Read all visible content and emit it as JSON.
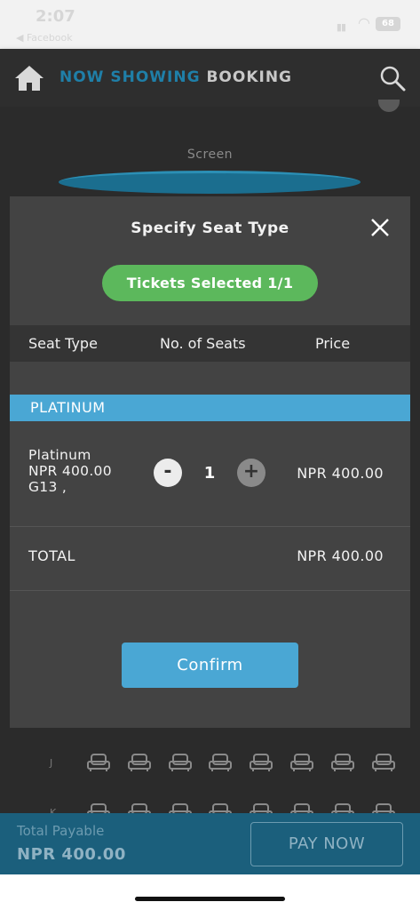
{
  "status_bar": {
    "time": "2:07",
    "back_label": "◀ Facebook",
    "signal": "▮▮",
    "wifi": "◠",
    "battery": "68"
  },
  "header": {
    "title_part1": "NOW SHOWING",
    "title_part2": "BOOKING",
    "home_icon": "home-icon",
    "search_icon": "search-icon"
  },
  "seat_map": {
    "screen_label": "Screen",
    "rows": [
      "J",
      "K"
    ],
    "seats_per_row": 8
  },
  "modal": {
    "title": "Specify Seat Type",
    "tickets_selected": "Tickets Selected 1/1",
    "columns": [
      "Seat Type",
      "No. of Seats",
      "Price"
    ],
    "section": "PLATINUM",
    "item": {
      "name": "Platinum",
      "unit_price": "NPR 400.00",
      "seats": "G13 ,",
      "minus": "-",
      "quantity": "1",
      "plus": "+",
      "price": "NPR 400.00"
    },
    "total_label": "TOTAL",
    "total_value": "NPR 400.00",
    "confirm_label": "Confirm"
  },
  "pay_bar": {
    "label": "Total Payable",
    "amount": "NPR 400.00",
    "pay_now_label": "PAY NOW"
  },
  "colors": {
    "accent_blue": "#4aa7d4",
    "green": "#5cb85c",
    "header_blue": "#1f7fa8",
    "modal_bg": "#434343"
  }
}
